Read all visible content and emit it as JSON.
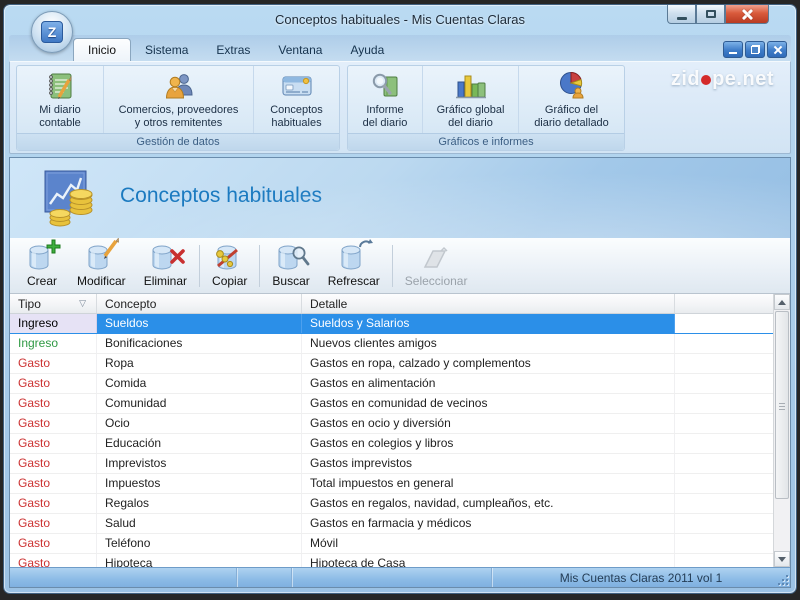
{
  "window": {
    "title": "Conceptos habituales - Mis Cuentas Claras",
    "app_letter": "Z"
  },
  "tabs": {
    "items": [
      {
        "label": "Inicio"
      },
      {
        "label": "Sistema"
      },
      {
        "label": "Extras"
      },
      {
        "label": "Ventana"
      },
      {
        "label": "Ayuda"
      }
    ]
  },
  "ribbon": {
    "brand_pre": "zid",
    "brand_post": "pe.net",
    "groups": [
      {
        "label": "Gestión de datos",
        "buttons": [
          {
            "line1": "Mi diario",
            "line2": "contable"
          },
          {
            "line1": "Comercios, proveedores",
            "line2": "y otros remitentes"
          },
          {
            "line1": "Conceptos",
            "line2": "habituales"
          }
        ]
      },
      {
        "label": "Gráficos e informes",
        "buttons": [
          {
            "line1": "Informe",
            "line2": "del diario"
          },
          {
            "line1": "Gráfico global",
            "line2": "del diario"
          },
          {
            "line1": "Gráfico del",
            "line2": "diario detallado"
          }
        ]
      }
    ]
  },
  "page": {
    "title": "Conceptos habituales"
  },
  "toolbar": {
    "buttons": [
      {
        "label": "Crear"
      },
      {
        "label": "Modificar"
      },
      {
        "label": "Eliminar"
      },
      {
        "label": "Copiar"
      },
      {
        "label": "Buscar"
      },
      {
        "label": "Refrescar"
      },
      {
        "label": "Seleccionar"
      }
    ]
  },
  "table": {
    "columns": [
      {
        "label": "Tipo"
      },
      {
        "label": "Concepto"
      },
      {
        "label": "Detalle"
      }
    ],
    "rows": [
      {
        "tipo": "Ingreso",
        "concepto": "Sueldos",
        "detalle": "Sueldos y Salarios"
      },
      {
        "tipo": "Ingreso",
        "concepto": "Bonificaciones",
        "detalle": "Nuevos clientes amigos"
      },
      {
        "tipo": "Gasto",
        "concepto": "Ropa",
        "detalle": "Gastos en ropa, calzado y complementos"
      },
      {
        "tipo": "Gasto",
        "concepto": "Comida",
        "detalle": "Gastos en alimentación"
      },
      {
        "tipo": "Gasto",
        "concepto": "Comunidad",
        "detalle": "Gastos en comunidad de vecinos"
      },
      {
        "tipo": "Gasto",
        "concepto": "Ocio",
        "detalle": "Gastos en ocio y diversión"
      },
      {
        "tipo": "Gasto",
        "concepto": "Educación",
        "detalle": "Gastos en colegios y libros"
      },
      {
        "tipo": "Gasto",
        "concepto": "Imprevistos",
        "detalle": "Gastos imprevistos"
      },
      {
        "tipo": "Gasto",
        "concepto": "Impuestos",
        "detalle": "Total impuestos en general"
      },
      {
        "tipo": "Gasto",
        "concepto": "Regalos",
        "detalle": "Gastos en regalos, navidad, cumpleaños, etc."
      },
      {
        "tipo": "Gasto",
        "concepto": "Salud",
        "detalle": "Gastos en farmacia y médicos"
      },
      {
        "tipo": "Gasto",
        "concepto": "Teléfono",
        "detalle": "Móvil"
      },
      {
        "tipo": "Gasto",
        "concepto": "Hipoteca",
        "detalle": "Hipoteca de Casa"
      }
    ]
  },
  "statusbar": {
    "text": "Mis Cuentas Claras 2011 vol 1"
  },
  "colors": {
    "selection_blue": "#2b8fe8",
    "ingreso_green": "#2f9944",
    "gasto_red": "#cc3333",
    "page_title_blue": "#1b7ac0",
    "brand_dot_red": "#d42a2a",
    "frame_blue": "#9cc2e4"
  }
}
